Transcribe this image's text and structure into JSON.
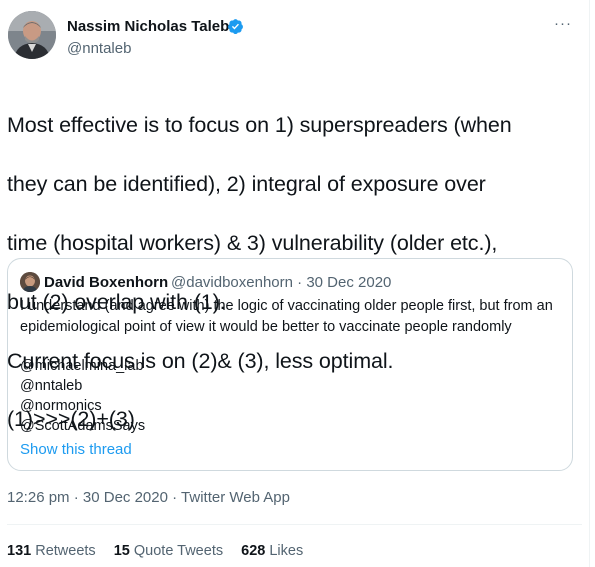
{
  "author": {
    "name": "Nassim Nicholas Taleb",
    "handle": "@nntaleb",
    "verified": true
  },
  "tweet": {
    "text_lines": [
      "Most effective is to focus on 1) superspreaders (when",
      "they can be identified), 2)  integral of exposure over",
      "time (hospital workers) & 3) vulnerability (older etc.),",
      "but (2) overlap with (1).",
      "Current focus is on (2)& (3), less optimal.",
      "(1)>>>(2)+(3)"
    ]
  },
  "quoted": {
    "name": "David Boxenhorn",
    "handle": "@davidboxenhorn",
    "date": "30 Dec 2020",
    "separator": "·",
    "body": "I understand (and agree with) the logic of vaccinating older people first, but from an epidemiological point of view it would be better to vaccinate people randomly",
    "mentions": [
      "@michaelmina_lab",
      "@nntaleb",
      "@normonics",
      "@ScottAdamsSays"
    ],
    "show_thread": "Show this thread"
  },
  "meta": {
    "time": "12:26 pm",
    "date": "30 Dec 2020",
    "source": "Twitter Web App",
    "separator": "·"
  },
  "stats": {
    "retweets_count": "131",
    "retweets_label": "Retweets",
    "quotes_count": "15",
    "quotes_label": "Quote Tweets",
    "likes_count": "628",
    "likes_label": "Likes"
  },
  "icons": {
    "more": "more-icon",
    "verified": "verified-badge-icon"
  },
  "colors": {
    "accent": "#1d9bf0",
    "text": "#0f1419",
    "secondary": "#536471",
    "border": "#cfd9de"
  }
}
